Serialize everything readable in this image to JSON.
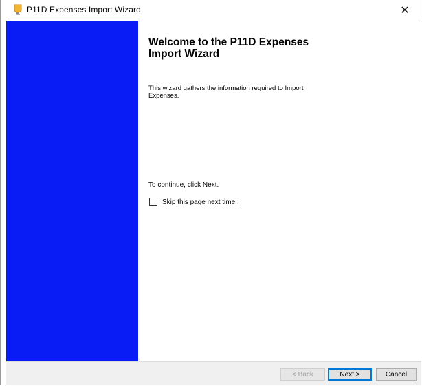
{
  "window": {
    "title": "P11D Expenses Import Wizard",
    "icon": "wizard-app-icon",
    "close_glyph": "✕"
  },
  "banner": {
    "color": "#0a1cf5"
  },
  "content": {
    "heading": "Welcome to the P11D Expenses Import Wizard",
    "description": "This wizard gathers the information required to Import Expenses.",
    "continue_text": "To continue, click Next.",
    "skip_label": "Skip this page next time :",
    "skip_checked": false
  },
  "footer": {
    "back_label": "< Back",
    "back_enabled": false,
    "next_label": "Next >",
    "cancel_label": "Cancel"
  }
}
